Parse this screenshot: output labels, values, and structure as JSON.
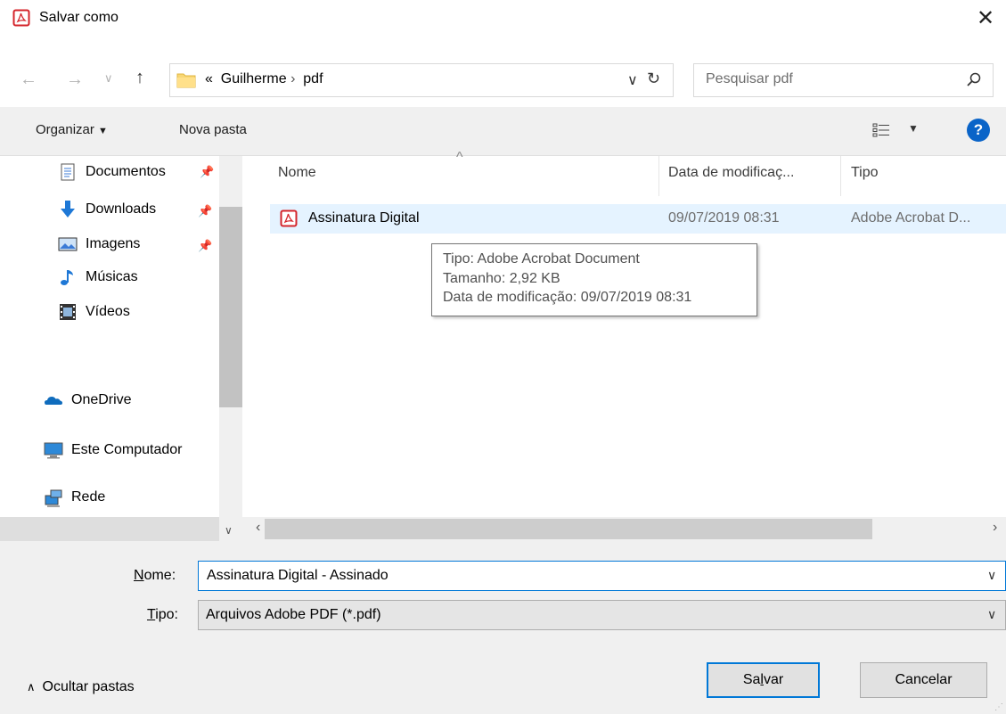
{
  "window": {
    "title": "Salvar como",
    "close": "✕"
  },
  "address": {
    "path_prefix": "«",
    "crumbs": [
      "Guilherme",
      "pdf"
    ],
    "separator": "›",
    "search_placeholder": "Pesquisar pdf"
  },
  "toolbar": {
    "organize": "Organizar",
    "new_folder": "Nova pasta",
    "help": "?"
  },
  "nav": {
    "items": [
      {
        "label": "Documentos",
        "icon": "documents-icon",
        "pinned": true
      },
      {
        "label": "Downloads",
        "icon": "downloads-icon",
        "pinned": true
      },
      {
        "label": "Imagens",
        "icon": "pictures-icon",
        "pinned": true
      },
      {
        "label": "Músicas",
        "icon": "music-icon",
        "pinned": false
      },
      {
        "label": "Vídeos",
        "icon": "videos-icon",
        "pinned": false
      },
      {
        "label": "OneDrive",
        "icon": "onedrive-icon",
        "pinned": false
      },
      {
        "label": "Este Computador",
        "icon": "this-pc-icon",
        "pinned": false
      },
      {
        "label": "Rede",
        "icon": "network-icon",
        "pinned": false
      }
    ]
  },
  "files": {
    "columns": [
      "Nome",
      "Data de modificaç...",
      "Tipo"
    ],
    "rows": [
      {
        "name": "Assinatura Digital",
        "date": "09/07/2019 08:31",
        "type": "Adobe Acrobat D..."
      }
    ],
    "tooltip": [
      "Tipo: Adobe Acrobat Document",
      "Tamanho: 2,92 KB",
      "Data de modificação: 09/07/2019 08:31"
    ]
  },
  "form": {
    "name_label_first": "N",
    "name_label_rest": "ome:",
    "name_value": "Assinatura Digital - Assinado",
    "type_label_first": "T",
    "type_label_rest": "ipo:",
    "type_value": "Arquivos Adobe PDF (*.pdf)"
  },
  "footer": {
    "hide_folders": "Ocultar pastas",
    "save_first": "Sa",
    "save_under": "l",
    "save_rest": "var",
    "cancel": "Cancelar"
  },
  "colors": {
    "accent": "#0078d7",
    "selection": "#e5f3ff",
    "pdf_red": "#d4242b",
    "help_blue": "#0a64c8"
  }
}
